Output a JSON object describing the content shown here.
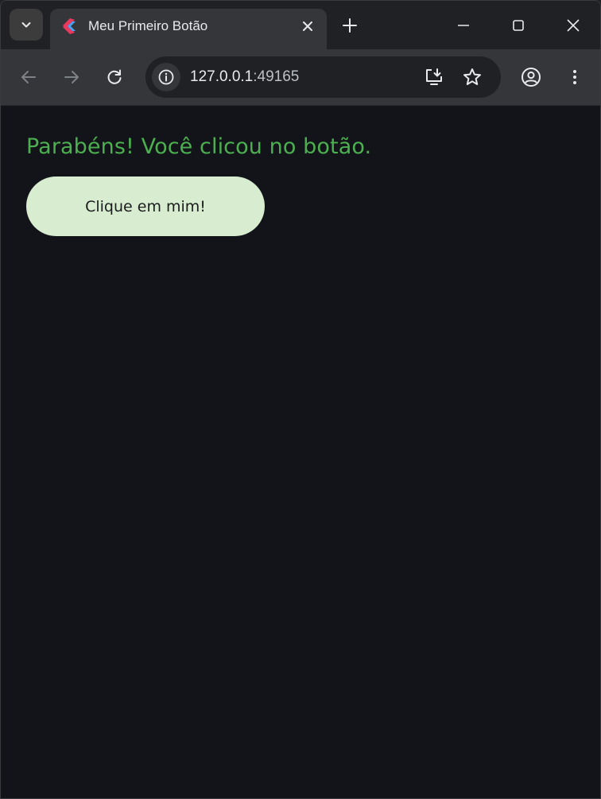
{
  "browser": {
    "tab": {
      "title": "Meu Primeiro Botão"
    },
    "address_bar": {
      "host": "127.0.0.1",
      "port": ":49165"
    },
    "icons": {
      "tab_search": "chevron-down-icon",
      "tab_favicon": "flutter-icon",
      "tab_close": "close-icon",
      "new_tab": "plus-icon",
      "minimize": "minimize-icon",
      "maximize": "maximize-icon",
      "window_close": "close-icon",
      "back": "arrow-left-icon",
      "forward": "arrow-right-icon",
      "reload": "reload-icon",
      "site_info": "info-icon",
      "install": "install-app-icon",
      "bookmark": "star-icon",
      "profile": "account-circle-icon",
      "menu": "more-vert-icon"
    },
    "colors": {
      "frame": "#202124",
      "toolbar": "#35363a",
      "page_background": "#121419"
    }
  },
  "page": {
    "message": "Parabéns! Você clicou no botão.",
    "button_label": "Clique em mim!",
    "colors": {
      "message": "#4caf50",
      "button_background": "#d8ecd0",
      "button_text": "#1a1c1e"
    }
  }
}
